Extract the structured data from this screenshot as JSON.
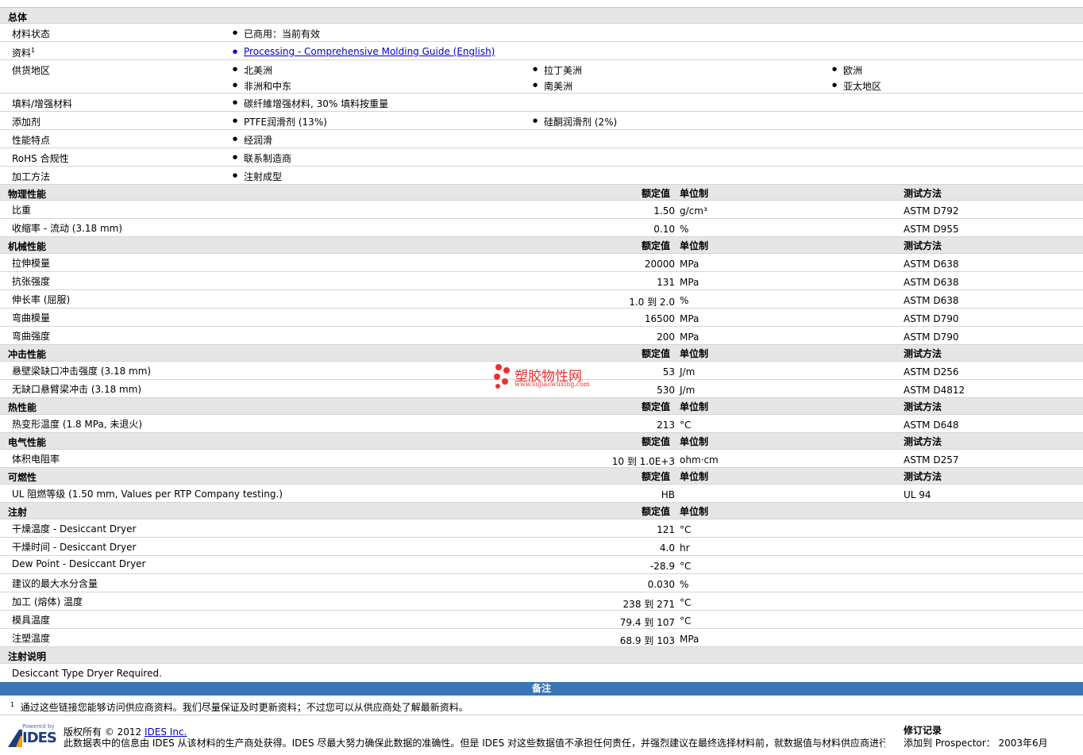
{
  "general": {
    "title": "总体",
    "rows": [
      {
        "label": "材料状态",
        "items": [
          "已商用：当前有效"
        ]
      },
      {
        "label": "资料",
        "sup": "1",
        "items": [
          "Processing - Comprehensive Molding Guide (English)"
        ]
      },
      {
        "label": "供货地区",
        "items": [
          "北美洲",
          "拉丁美洲",
          "欧洲",
          "非洲和中东",
          "南美洲",
          "亚太地区"
        ]
      },
      {
        "label": "填料/增强材料",
        "items": [
          "碳纤維增强材料, 30% 填料按重量"
        ]
      },
      {
        "label": "添加剂",
        "items": [
          "PTFE润滑剂 (13%)",
          "硅酮润滑剂 (2%)"
        ]
      },
      {
        "label": "性能特点",
        "items": [
          "经润滑"
        ]
      },
      {
        "label": "RoHS 合规性",
        "items": [
          "联系制造商"
        ]
      },
      {
        "label": "加工方法",
        "items": [
          "注射成型"
        ]
      }
    ]
  },
  "headers": {
    "nominal": "额定值",
    "unit": "单位制",
    "method": "测试方法"
  },
  "sections": [
    {
      "title": "物理性能",
      "method_header": true,
      "rows": [
        {
          "label": "比重",
          "value": "1.50",
          "unit": "g/cm³",
          "method": "ASTM D792"
        },
        {
          "label": "收缩率 - 流动 (3.18 mm)",
          "value": "0.10",
          "unit": "%",
          "method": "ASTM D955"
        }
      ]
    },
    {
      "title": "机械性能",
      "method_header": true,
      "rows": [
        {
          "label": "拉伸模量",
          "value": "20000",
          "unit": "MPa",
          "method": "ASTM D638"
        },
        {
          "label": "抗张强度",
          "value": "131",
          "unit": "MPa",
          "method": "ASTM D638"
        },
        {
          "label": "伸长率 (屈服)",
          "value": "1.0 到  2.0",
          "unit": "%",
          "method": "ASTM D638"
        },
        {
          "label": "弯曲模量",
          "value": "16500",
          "unit": "MPa",
          "method": "ASTM D790"
        },
        {
          "label": "弯曲强度",
          "value": "200",
          "unit": "MPa",
          "method": "ASTM D790"
        }
      ]
    },
    {
      "title": "冲击性能",
      "method_header": true,
      "rows": [
        {
          "label": "悬壁梁缺口冲击强度 (3.18 mm)",
          "value": "53",
          "unit": "J/m",
          "method": "ASTM D256"
        },
        {
          "label": "无缺口悬臂梁冲击 (3.18 mm)",
          "value": "530",
          "unit": "J/m",
          "method": "ASTM D4812"
        }
      ]
    },
    {
      "title": "热性能",
      "method_header": true,
      "rows": [
        {
          "label": "热变形温度 (1.8 MPa, 未退火)",
          "value": "213",
          "unit": "°C",
          "method": "ASTM D648"
        }
      ]
    },
    {
      "title": "电气性能",
      "method_header": true,
      "rows": [
        {
          "label": "体积电阻率",
          "value": "10 到  1.0E+3",
          "unit": "ohm·cm",
          "method": "ASTM D257"
        }
      ]
    },
    {
      "title": "可燃性",
      "method_header": true,
      "rows": [
        {
          "label": "UL 阻燃等级 (1.50 mm, Values per RTP Company testing.)",
          "value": "HB",
          "unit": "",
          "method": "UL 94"
        }
      ]
    },
    {
      "title": "注射",
      "method_header": false,
      "rows": [
        {
          "label": "干燥温度 - Desiccant Dryer",
          "value": "121",
          "unit": "°C",
          "method": ""
        },
        {
          "label": "干燥时间 - Desiccant Dryer",
          "value": "4.0",
          "unit": "hr",
          "method": ""
        },
        {
          "label": "Dew Point - Desiccant Dryer",
          "value": "-28.9",
          "unit": "°C",
          "method": ""
        },
        {
          "label": "建议的最大水分含量",
          "value": "0.030",
          "unit": "%",
          "method": ""
        },
        {
          "label": "加工 (熔体) 温度",
          "value": "238 到  271",
          "unit": "°C",
          "method": ""
        },
        {
          "label": "模具温度",
          "value": "79.4 到  107",
          "unit": "°C",
          "method": ""
        },
        {
          "label": "注塑温度",
          "value": "68.9 到  103",
          "unit": "MPa",
          "method": ""
        }
      ]
    }
  ],
  "injection_notes": {
    "title": "注射说明",
    "text": "Desiccant Type Dryer Required."
  },
  "notes": {
    "title": "备注",
    "sup": "1",
    "text": "通过这些链接您能够访问供应商资料。我们尽量保证及时更新资料；不过您可以从供应商处了解最新资料。"
  },
  "watermark": {
    "name": "塑胶物性网",
    "url": "www.sujiaowuxing.com"
  },
  "footer": {
    "powered_by": "Powered by",
    "logo": "IDES",
    "copyright": "版权所有 © 2012",
    "company": "IDES Inc.",
    "disclaimer": "此数据表中的信息由 IDES 从该材料的生产商处获得。IDES 尽最大努力确保此数据的准确性。但是 IDES 对这些数据值不承担任何责任，并强烈建议在最终选择材料前，就数据值与材料供应商进行验",
    "revision_title": "修订记录",
    "revision_text": "添加到 Prospector： 2003年6月"
  }
}
